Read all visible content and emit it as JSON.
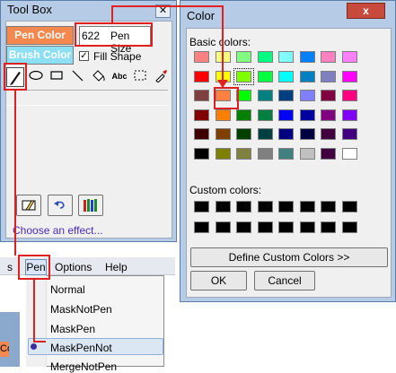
{
  "toolbox": {
    "title": "Tool Box",
    "close_label": "✕",
    "pen_color_label": "Pen Color",
    "brush_color_label": "Brush Color",
    "pen_size_value": "622",
    "pen_size_label": "Pen Size",
    "fill_shape_label": "Fill Shape",
    "fill_shape_checked": true,
    "tools": [
      "pen-icon",
      "ellipse-icon",
      "rectangle-icon",
      "line-icon",
      "fill-bucket-icon",
      "text-icon",
      "select-icon",
      "eyedropper-icon"
    ],
    "text_tool_label": "Abc",
    "bottom_buttons": [
      "eraser-icon",
      "undo-icon",
      "crayons-icon"
    ],
    "effect_link": "Choose an effect...",
    "pen_color": "#f4884e",
    "brush_color": "#8de0f4"
  },
  "color_dialog": {
    "title": "Color",
    "close_label": "x",
    "basic_colors_label": "Basic colors:",
    "custom_colors_label": "Custom colors:",
    "define_custom_label": "Define Custom Colors >>",
    "ok_label": "OK",
    "cancel_label": "Cancel",
    "selected_index": 10,
    "basic_colors": [
      "#ff8080",
      "#ffff80",
      "#80ff80",
      "#00ff80",
      "#80ffff",
      "#0080ff",
      "#ff80c0",
      "#ff80ff",
      "#ff0000",
      "#ffff00",
      "#80ff00",
      "#00ff40",
      "#00ffff",
      "#0080c0",
      "#8080c0",
      "#ff00ff",
      "#804040",
      "#ff8040",
      "#00ff00",
      "#008080",
      "#004080",
      "#8080ff",
      "#800040",
      "#ff0080",
      "#800000",
      "#ff8000",
      "#008000",
      "#008040",
      "#0000ff",
      "#0000a0",
      "#800080",
      "#8000ff",
      "#400000",
      "#804000",
      "#004000",
      "#004040",
      "#000080",
      "#000040",
      "#400040",
      "#400080",
      "#000000",
      "#808000",
      "#808040",
      "#808080",
      "#408080",
      "#c0c0c0",
      "#400040",
      "#ffffff"
    ],
    "custom_colors": [
      "#000000",
      "#000000",
      "#000000",
      "#000000",
      "#000000",
      "#000000",
      "#000000",
      "#000000",
      "#000000",
      "#000000",
      "#000000",
      "#000000",
      "#000000",
      "#000000",
      "#000000",
      "#000000"
    ]
  },
  "menu": {
    "partial_left": "s",
    "items": [
      "Pen",
      "Options",
      "Help"
    ],
    "pen_dropdown": [
      "Normal",
      "MaskNotPen",
      "MaskPen",
      "MaskPenNot",
      "MergeNotPen"
    ],
    "selected_item": "MaskPenNot",
    "partial_strip_text": "Co"
  },
  "annotation_color": "#e02020"
}
